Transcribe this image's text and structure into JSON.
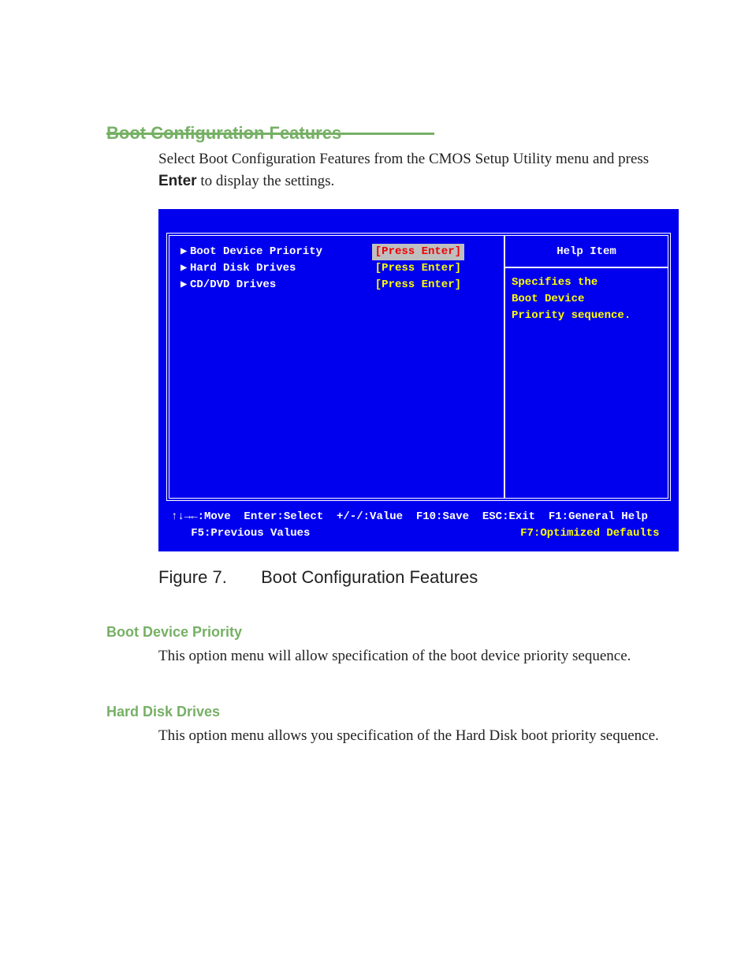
{
  "section": {
    "title": "Boot Configuration Features",
    "intro_pre": "Select Boot Configuration Features from the CMOS Setup Utility menu and press ",
    "intro_key": "Enter",
    "intro_post": " to display the settings."
  },
  "bios": {
    "rows": [
      {
        "label": "Boot Device Priority",
        "value": "[Press Enter]",
        "selected": true
      },
      {
        "label": "Hard Disk Drives",
        "value": "[Press Enter]",
        "selected": false
      },
      {
        "label": "CD/DVD Drives",
        "value": "[Press Enter]",
        "selected": false
      }
    ],
    "help": {
      "title": "Help Item",
      "body": "Specifies the\nBoot Device\nPriority sequence."
    },
    "footer": {
      "line1": "↑↓→←:Move  Enter:Select  +/-/:Value  F10:Save  ESC:Exit  F1:General Help",
      "line2_left": "   F5:Previous Values",
      "line2_right": "F7:Optimized Defaults "
    }
  },
  "figure": {
    "num": "Figure 7.",
    "title": "Boot Configuration Features"
  },
  "sub1": {
    "heading": "Boot Device Priority",
    "text": "This option menu will allow specification of the boot device priority sequence."
  },
  "sub2": {
    "heading": "Hard Disk Drives",
    "text": "This option menu allows you specification of the Hard Disk boot priority sequence."
  }
}
